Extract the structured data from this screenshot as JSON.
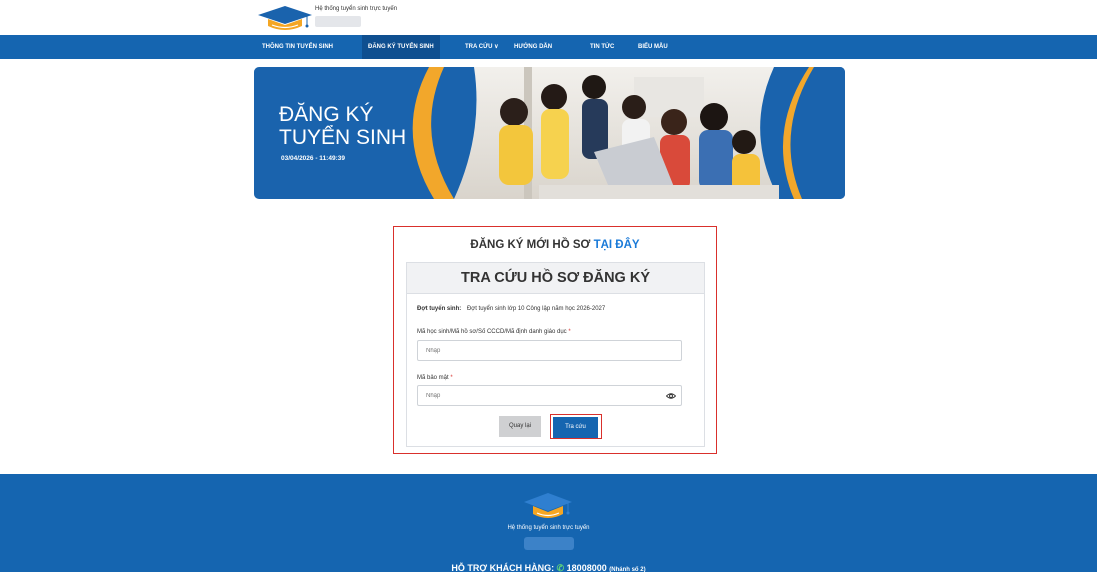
{
  "header": {
    "site_name": "Hệ thống tuyển sinh trực tuyến"
  },
  "nav": {
    "items": [
      {
        "label": "THÔNG TIN TUYỂN SINH"
      },
      {
        "label": "ĐĂNG KÝ TUYỂN SINH"
      },
      {
        "label": "TRA CỨU ∨"
      },
      {
        "label": "HƯỚNG DẪN"
      },
      {
        "label": "TIN TỨC"
      },
      {
        "label": "BIỂU MẪU"
      }
    ],
    "active_index": 1
  },
  "banner": {
    "title_line1": "ĐĂNG KÝ",
    "title_line2": "TUYỂN SINH",
    "datetime": "03/04/2026 - 11:49:39"
  },
  "register": {
    "heading_prefix": "ĐĂNG KÝ MỚI HỒ SƠ",
    "heading_link": "TẠI ĐÂY"
  },
  "lookup": {
    "title": "TRA CỨU HỒ SƠ ĐĂNG KÝ",
    "period_label": "Đợt tuyển sinh:",
    "period_value": "Đợt tuyển sinh lớp 10 Công lập năm học 2026-2027",
    "id_label": "Mã học sinh/Mã hồ sơ/Số CCCD/Mã định danh giáo dục",
    "id_placeholder": "Nhập",
    "security_label": "Mã bảo mật",
    "security_placeholder": "Nhập",
    "required_mark": "*",
    "back_button": "Quay lại",
    "search_button": "Tra cứu"
  },
  "footer": {
    "site_name": "Hệ thống tuyển sinh trực tuyến",
    "support_label": "HỖ TRỢ KHÁCH HÀNG:",
    "phone": "18008000",
    "phone_note": "(Nhánh số 2)"
  },
  "colors": {
    "primary": "#1565b0",
    "accent_red": "#d9302c",
    "link": "#1a7ad8"
  }
}
